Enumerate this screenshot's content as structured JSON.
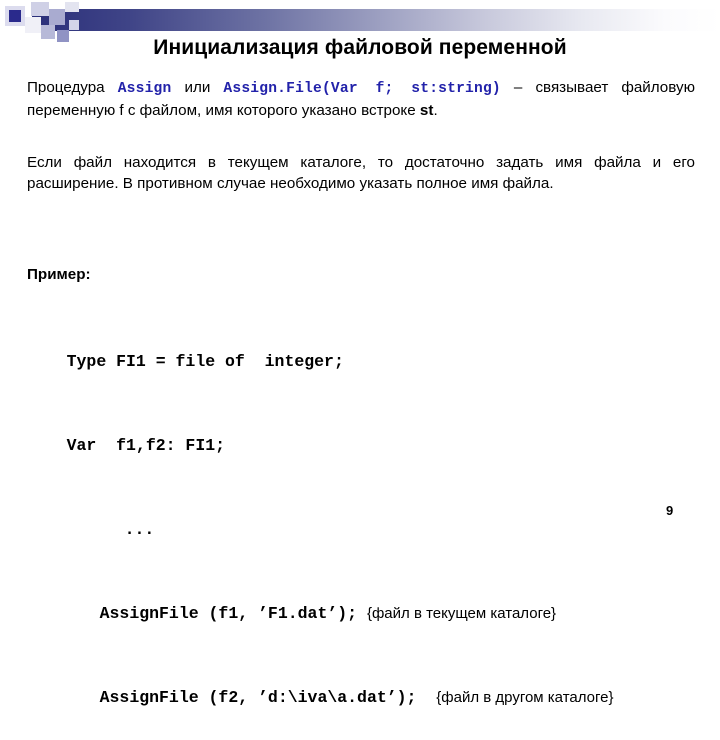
{
  "slide": {
    "title": "Инициализация файловой переменной",
    "page_number": "9"
  },
  "decoration": {
    "bar_color_start": "#2b2f7a",
    "bar_color_end": "#ffffff",
    "square_accent": "#2a2a8c"
  },
  "body": {
    "paragraph1": {
      "lead": "Процедура ",
      "code1": "Assign",
      "mid": " или ",
      "code2": "Assign.File",
      "code3": "(Var  f;  st:string)",
      "dash": " – ",
      "rest_line2": "связывает файловую переменную f с файлом, имя которого указано в",
      "rest_line3_pre": "строке ",
      "rest_line3_bold": "st",
      "rest_line3_post": "."
    },
    "paragraph2": {
      "line1": "Если файл находится в текущем каталоге, то достаточно задать имя",
      "line2": "файла и его расширение. В противном случае необходимо указать",
      "line3": "полное имя файла."
    },
    "example_label": "Пример:"
  },
  "code": {
    "lines": [
      {
        "text": "Type FI1 = file of  integer;",
        "indent": 0,
        "comment": ""
      },
      {
        "text": "Var  f1,f2: FI1;",
        "indent": 0,
        "comment": ""
      },
      {
        "text": "...",
        "indent": 2,
        "comment": ""
      },
      {
        "text": "AssignFile (f1, ’F1.dat’); ",
        "indent": 1,
        "comment": "{файл в текущем каталоге}"
      },
      {
        "text": "AssignFile (f2, ’d:\\iva\\a.dat’);  ",
        "indent": 1,
        "comment": "{файл в другом каталоге}"
      }
    ]
  },
  "colors": {
    "code_blue": "#2222aa",
    "text_black": "#000000",
    "background": "#ffffff"
  }
}
